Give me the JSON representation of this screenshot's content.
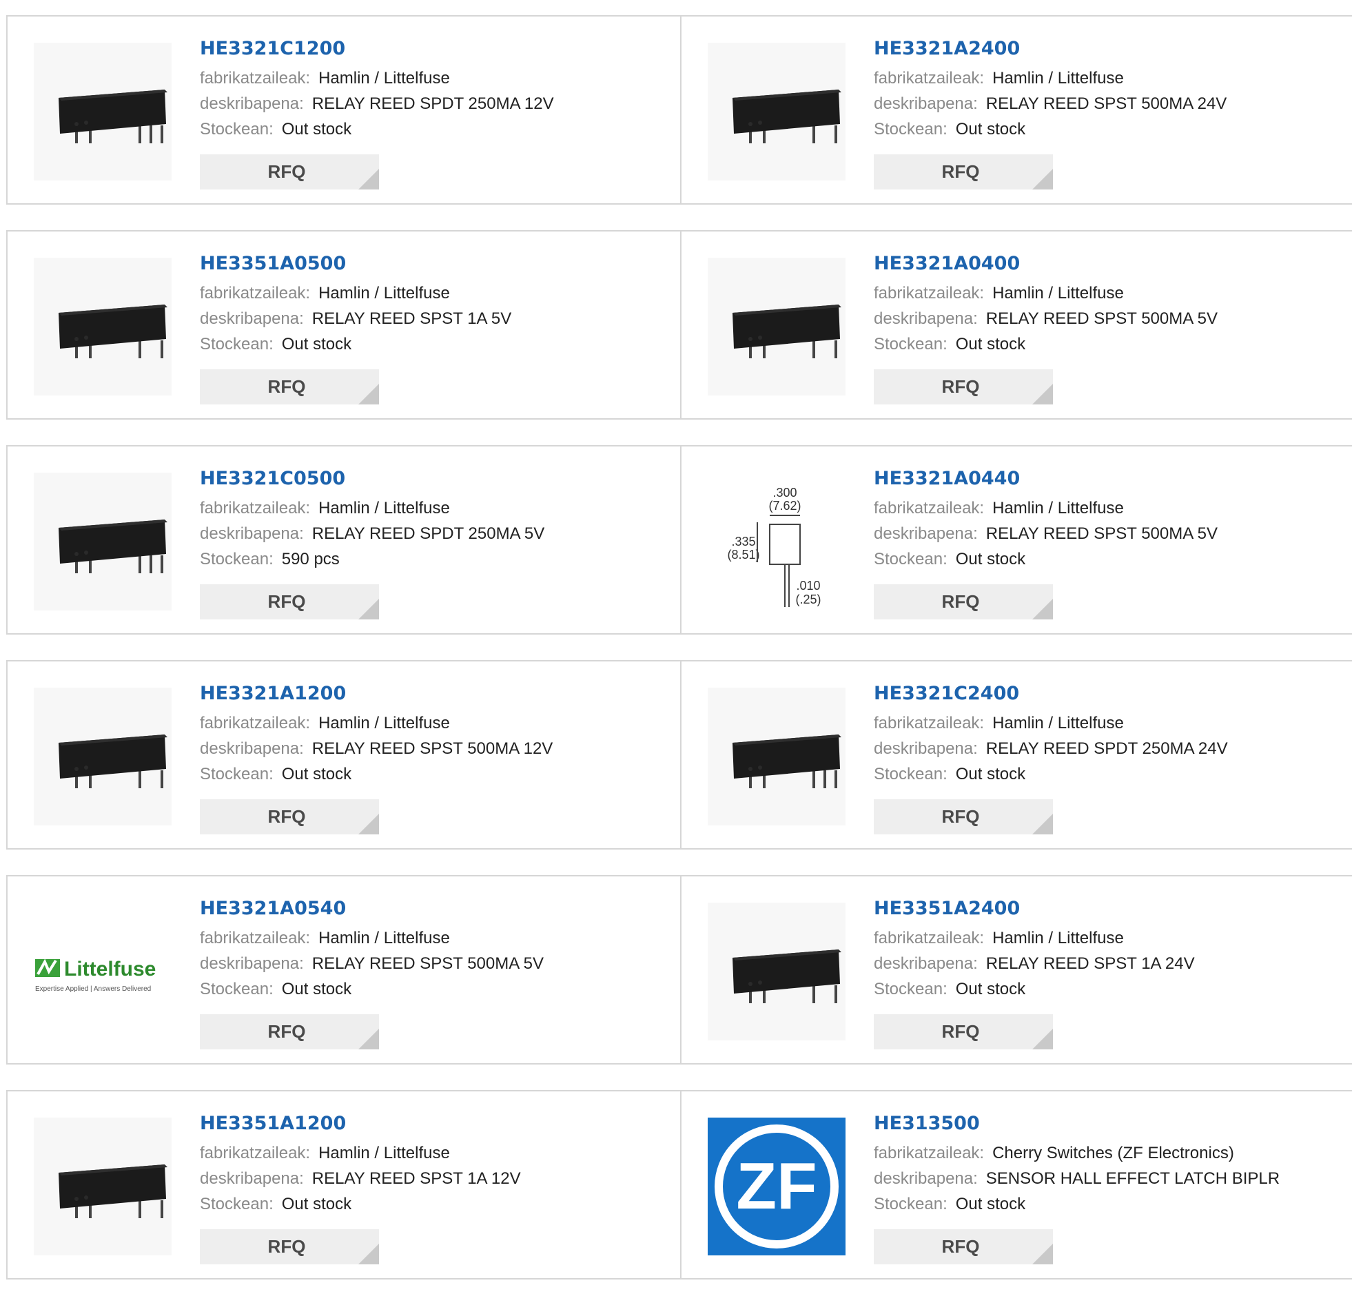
{
  "labels": {
    "manufacturer": "fabrikatzaileak:",
    "description": "deskribapena:",
    "stock": "Stockean:",
    "rfq": "RFQ"
  },
  "colors": {
    "part_link": "#1d63ad",
    "label_gray": "#8a8a8a",
    "button_bg": "#eeeeee",
    "border": "#d6d6d6"
  },
  "rows": [
    [
      {
        "part": "HE3321C1200",
        "manufacturer": "Hamlin / Littelfuse",
        "description": "RELAY REED SPDT 250MA 12V",
        "stock": "Out stock",
        "image": "reed-relay-4pin-icon"
      },
      {
        "part": "HE3321A2400",
        "manufacturer": "Hamlin / Littelfuse",
        "description": "RELAY REED SPST 500MA 24V",
        "stock": "Out stock",
        "image": "reed-relay-icon"
      }
    ],
    [
      {
        "part": "HE3351A0500",
        "manufacturer": "Hamlin / Littelfuse",
        "description": "RELAY REED SPST 1A 5V",
        "stock": "Out stock",
        "image": "reed-relay-icon"
      },
      {
        "part": "HE3321A0400",
        "manufacturer": "Hamlin / Littelfuse",
        "description": "RELAY REED SPST 500MA 5V",
        "stock": "Out stock",
        "image": "reed-relay-icon"
      }
    ],
    [
      {
        "part": "HE3321C0500",
        "manufacturer": "Hamlin / Littelfuse",
        "description": "RELAY REED SPDT 250MA 5V",
        "stock": "590 pcs",
        "image": "reed-relay-4pin-icon"
      },
      {
        "part": "HE3321A0440",
        "manufacturer": "Hamlin / Littelfuse",
        "description": "RELAY REED SPST 500MA 5V",
        "stock": "Out stock",
        "image": "dimension-drawing-icon",
        "drawing": {
          "top": ".300",
          "top_mm": "(7.62)",
          "side": ".335",
          "side_mm": "(8.51)",
          "pin": ".010",
          "pin_mm": "(.25)"
        }
      }
    ],
    [
      {
        "part": "HE3321A1200",
        "manufacturer": "Hamlin / Littelfuse",
        "description": "RELAY REED SPST 500MA 12V",
        "stock": "Out stock",
        "image": "reed-relay-icon"
      },
      {
        "part": "HE3321C2400",
        "manufacturer": "Hamlin / Littelfuse",
        "description": "RELAY REED SPDT 250MA 24V",
        "stock": "Out stock",
        "image": "reed-relay-4pin-icon"
      }
    ],
    [
      {
        "part": "HE3321A0540",
        "manufacturer": "Hamlin / Littelfuse",
        "description": "RELAY REED SPST 500MA 5V",
        "stock": "Out stock",
        "image": "littelfuse-logo",
        "logo": {
          "name": "Littelfuse",
          "tagline": "Expertise Applied | Answers Delivered"
        }
      },
      {
        "part": "HE3351A2400",
        "manufacturer": "Hamlin / Littelfuse",
        "description": "RELAY REED SPST 1A 24V",
        "stock": "Out stock",
        "image": "reed-relay-icon"
      }
    ],
    [
      {
        "part": "HE3351A1200",
        "manufacturer": "Hamlin / Littelfuse",
        "description": "RELAY REED SPST 1A 12V",
        "stock": "Out stock",
        "image": "reed-relay-icon"
      },
      {
        "part": "HE313500",
        "manufacturer": "Cherry Switches (ZF Electronics)",
        "description": "SENSOR HALL EFFECT LATCH BIPLR",
        "stock": "Out stock",
        "image": "zf-logo",
        "logo": {
          "name": "ZF"
        }
      }
    ]
  ]
}
